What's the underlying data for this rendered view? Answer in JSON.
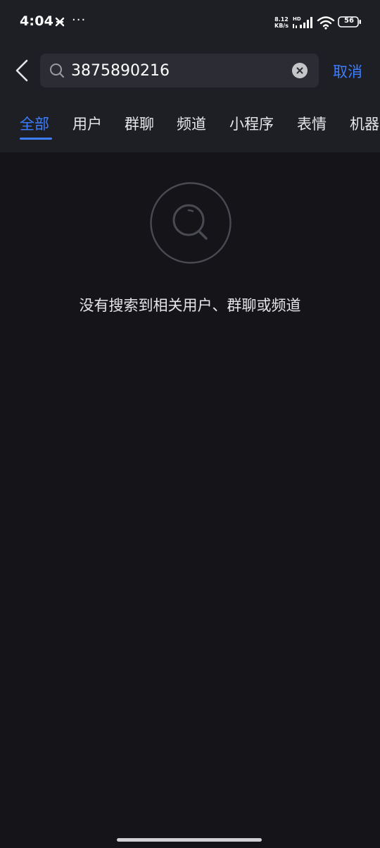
{
  "status_bar": {
    "time": "4:04",
    "more": "···",
    "net_speed": "8.12\nKB/s",
    "battery": "56"
  },
  "search": {
    "query": "3875890216",
    "cancel_label": "取消"
  },
  "tabs": [
    {
      "label": "全部",
      "active": true
    },
    {
      "label": "用户",
      "active": false
    },
    {
      "label": "群聊",
      "active": false
    },
    {
      "label": "频道",
      "active": false
    },
    {
      "label": "小程序",
      "active": false
    },
    {
      "label": "表情",
      "active": false
    },
    {
      "label": "机器",
      "active": false
    }
  ],
  "empty_state": {
    "message": "没有搜索到相关用户、群聊或频道"
  },
  "colors": {
    "accent": "#3d7dff",
    "background": "#141419",
    "header": "#1e1f25"
  }
}
